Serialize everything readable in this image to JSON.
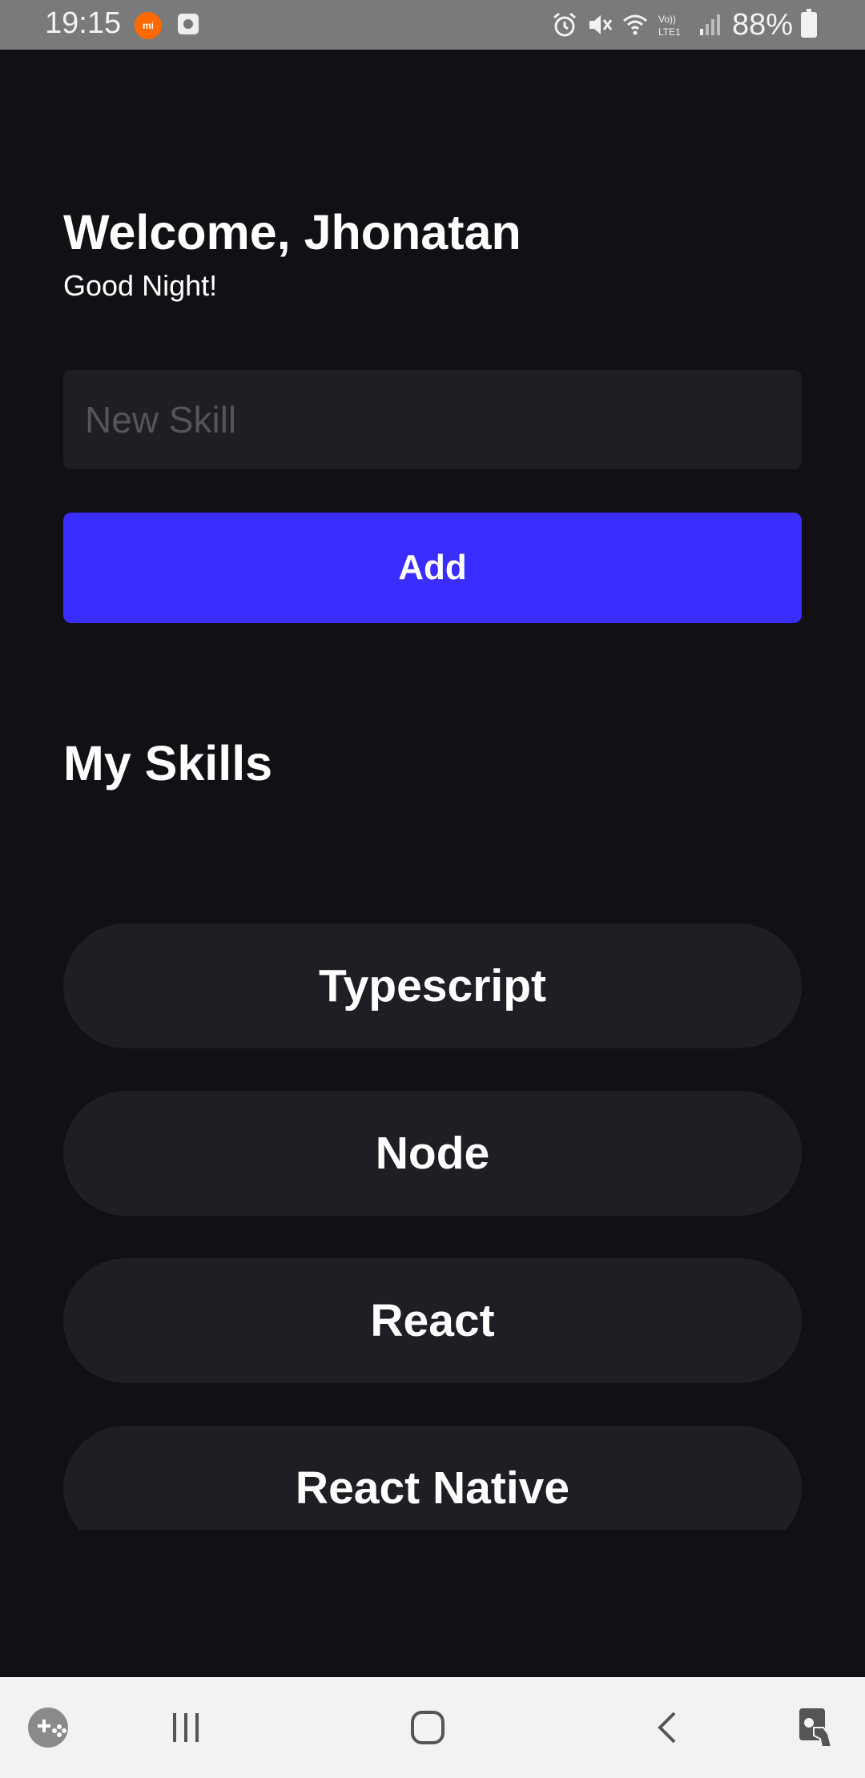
{
  "status_bar": {
    "time": "19:15",
    "battery_percent": "88%",
    "icons": [
      "mi-icon",
      "app-notification-icon",
      "alarm-icon",
      "mute-icon",
      "wifi-icon",
      "volte-icon",
      "signal-icon",
      "battery-charging-icon"
    ],
    "lte_label": "LTE1",
    "volte_label": "Vo))"
  },
  "header": {
    "welcome": "Welcome, Jhonatan",
    "greeting": "Good Night!"
  },
  "form": {
    "placeholder": "New Skill",
    "value": "",
    "add_label": "Add"
  },
  "skills": {
    "title": "My Skills",
    "items": [
      {
        "label": "Typescript"
      },
      {
        "label": "Node"
      },
      {
        "label": "React"
      },
      {
        "label": "React Native"
      }
    ]
  },
  "nav_bar": {
    "icons": [
      "game-launcher-icon",
      "recent-apps-icon",
      "home-icon",
      "back-icon",
      "accessibility-icon"
    ]
  },
  "colors": {
    "background": "#121015",
    "card": "#1f1e25",
    "accent": "#3a2dff",
    "status_bar": "#7a7a7a",
    "nav_bar": "#f2f2f2"
  }
}
